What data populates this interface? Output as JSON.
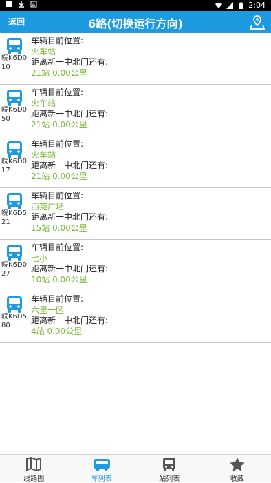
{
  "status_bar": {
    "time": "2:04",
    "icons": [
      "wifi-icon",
      "signal-icon",
      "battery-icon"
    ]
  },
  "header": {
    "back_label": "返回",
    "title": "6路(切换运行方向)",
    "right_icon": "map-location-icon",
    "color": "#1e9be0"
  },
  "vehicles": [
    {
      "plate": "皖K6D010",
      "position_label": "车辆目前位置:",
      "position": "火车站",
      "distance_label": "距离新一中北门还有:",
      "distance": "21站  0.00公里"
    },
    {
      "plate": "皖K6D050",
      "position_label": "车辆目前位置:",
      "position": "火车站",
      "distance_label": "距离新一中北门还有:",
      "distance": "21站  0.00公里"
    },
    {
      "plate": "皖K6D017",
      "position_label": "车辆目前位置:",
      "position": "火车站",
      "distance_label": "距离新一中北门还有:",
      "distance": "21站  0.00公里"
    },
    {
      "plate": "皖K6D521",
      "position_label": "车辆目前位置:",
      "position": "西苑广场",
      "distance_label": "距离新一中北门还有:",
      "distance": "15站  0.00公里"
    },
    {
      "plate": "皖K6D027",
      "position_label": "车辆目前位置:",
      "position": "七小",
      "distance_label": "距离新一中北门还有:",
      "distance": "10站  0.00公里"
    },
    {
      "plate": "皖K6D580",
      "position_label": "车辆目前位置:",
      "position": "六里一区",
      "distance_label": "距离新一中北门还有:",
      "distance": "4站  0.00公里"
    }
  ],
  "tabs": [
    {
      "label": "线路图",
      "icon": "map-icon",
      "active": false
    },
    {
      "label": "车列表",
      "icon": "bus-side-icon",
      "active": true
    },
    {
      "label": "站列表",
      "icon": "bus-front-icon",
      "active": false
    },
    {
      "label": "收藏",
      "icon": "star-icon",
      "active": false
    }
  ],
  "colors": {
    "accent": "#1e9be0",
    "value_green": "#7bb83a"
  }
}
